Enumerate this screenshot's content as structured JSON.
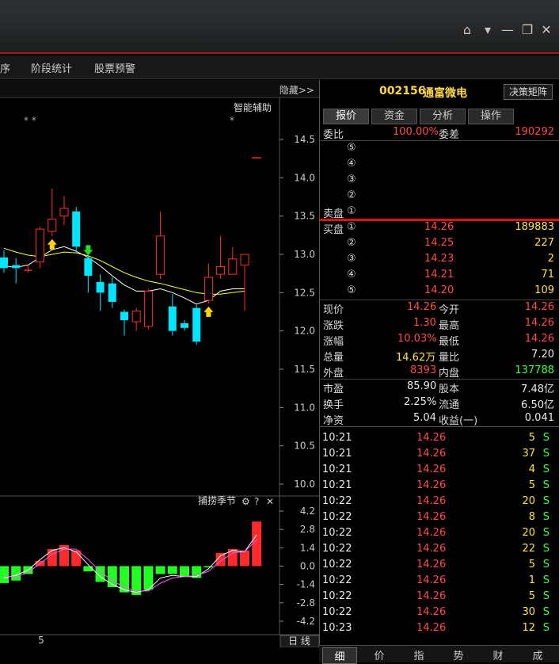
{
  "menu": {
    "items": [
      "序",
      "阶段统计",
      "股票预警"
    ]
  },
  "chart": {
    "hide_label": "隐藏>>",
    "assist_label": "智能辅助",
    "stars_left": "* *",
    "star_right": "*",
    "price_ticks": [
      "14.5",
      "14.0",
      "13.5",
      "13.0",
      "12.5",
      "12.0",
      "11.5",
      "11.0",
      "10.5",
      "10.0"
    ],
    "indicator_title": "捕捞季节",
    "indicator_ticks": [
      "4.2",
      "2.8",
      "1.4",
      "0.0",
      "-1.4",
      "-2.8",
      "-4.2"
    ],
    "date_label": "5",
    "period_label": "日 线",
    "colors": {
      "up": "#ff2b2b",
      "down": "#00e5ff",
      "ma1": "#ffffff",
      "ma2": "#ffff33",
      "macd_neg": "#22ff22"
    }
  },
  "stock": {
    "code": "002156",
    "name": "通富微电",
    "button": "决策矩阵"
  },
  "tabs": [
    "报价",
    "资金",
    "分析",
    "操作"
  ],
  "quote": {
    "wb_label": "委比",
    "wb_value": "100.00%",
    "wc_label": "委差",
    "wc_value": "190292",
    "sell_levels": [
      "⑤",
      "④",
      "③",
      "②",
      "①"
    ],
    "sell_label": "卖盘",
    "buy_label": "买盘",
    "buy_levels": [
      {
        "level": "①",
        "price": "14.26",
        "vol": "189883"
      },
      {
        "level": "②",
        "price": "14.25",
        "vol": "227"
      },
      {
        "level": "③",
        "price": "14.23",
        "vol": "2"
      },
      {
        "level": "④",
        "price": "14.21",
        "vol": "71"
      },
      {
        "level": "⑤",
        "price": "14.20",
        "vol": "109"
      }
    ],
    "stats": [
      {
        "l1": "现价",
        "v1": "14.26",
        "l2": "今开",
        "v2": "14.26"
      },
      {
        "l1": "涨跌",
        "v1": "1.30",
        "l2": "最高",
        "v2": "14.26"
      },
      {
        "l1": "涨幅",
        "v1": "10.03%",
        "l2": "最低",
        "v2": "14.26"
      },
      {
        "l1": "总量",
        "v1": "14.62万",
        "l2": "量比",
        "v2": "7.20"
      },
      {
        "l1": "外盘",
        "v1": "8393",
        "l2": "内盘",
        "v2": "137788"
      }
    ],
    "fund": [
      {
        "l1": "市盈",
        "v1": "85.90",
        "l2": "股本",
        "v2": "7.48亿"
      },
      {
        "l1": "换手",
        "v1": "2.25%",
        "l2": "流通",
        "v2": "6.50亿"
      },
      {
        "l1": "净资",
        "v1": "5.04",
        "l2": "收益(一)",
        "v2": "0.041"
      }
    ]
  },
  "ticks": [
    {
      "time": "10:21",
      "price": "14.26",
      "vol": "5",
      "side": "S"
    },
    {
      "time": "10:21",
      "price": "14.26",
      "vol": "37",
      "side": "S"
    },
    {
      "time": "10:21",
      "price": "14.26",
      "vol": "4",
      "side": "S"
    },
    {
      "time": "10:21",
      "price": "14.26",
      "vol": "5",
      "side": "S"
    },
    {
      "time": "10:22",
      "price": "14.26",
      "vol": "20",
      "side": "S"
    },
    {
      "time": "10:22",
      "price": "14.26",
      "vol": "8",
      "side": "S"
    },
    {
      "time": "10:22",
      "price": "14.26",
      "vol": "20",
      "side": "S"
    },
    {
      "time": "10:22",
      "price": "14.26",
      "vol": "22",
      "side": "S"
    },
    {
      "time": "10:22",
      "price": "14.26",
      "vol": "5",
      "side": "S"
    },
    {
      "time": "10:22",
      "price": "14.26",
      "vol": "1",
      "side": "S"
    },
    {
      "time": "10:22",
      "price": "14.26",
      "vol": "5",
      "side": "S"
    },
    {
      "time": "10:22",
      "price": "14.26",
      "vol": "30",
      "side": "S"
    },
    {
      "time": "10:23",
      "price": "14.26",
      "vol": "12",
      "side": "S"
    }
  ],
  "bottom_tabs": [
    "细",
    "价",
    "指",
    "势",
    "财",
    "成"
  ],
  "candles": [
    {
      "o": 12.96,
      "c": 12.82,
      "h": 13.05,
      "l": 12.76
    },
    {
      "o": 12.86,
      "c": 12.82,
      "h": 12.95,
      "l": 12.62
    },
    {
      "o": 12.79,
      "c": 12.8,
      "h": 12.86,
      "l": 12.76
    },
    {
      "o": 12.9,
      "c": 13.33,
      "h": 13.36,
      "l": 12.82
    },
    {
      "o": 13.3,
      "c": 13.46,
      "h": 13.86,
      "l": 13.24
    },
    {
      "o": 13.5,
      "c": 13.6,
      "h": 13.76,
      "l": 13.38
    },
    {
      "o": 13.56,
      "c": 13.1,
      "h": 13.62,
      "l": 13.02
    },
    {
      "o": 12.95,
      "c": 12.72,
      "h": 13.1,
      "l": 12.5
    },
    {
      "o": 12.64,
      "c": 12.5,
      "h": 12.74,
      "l": 12.26
    },
    {
      "o": 12.62,
      "c": 12.38,
      "h": 12.7,
      "l": 12.3
    },
    {
      "o": 12.25,
      "c": 12.14,
      "h": 12.28,
      "l": 11.94
    },
    {
      "o": 12.12,
      "c": 12.26,
      "h": 12.3,
      "l": 12.0
    },
    {
      "o": 12.06,
      "c": 12.52,
      "h": 12.55,
      "l": 12.02
    },
    {
      "o": 12.74,
      "c": 13.24,
      "h": 13.56,
      "l": 12.68
    },
    {
      "o": 12.32,
      "c": 12.0,
      "h": 12.48,
      "l": 11.94
    },
    {
      "o": 12.1,
      "c": 12.04,
      "h": 12.14,
      "l": 12.0
    },
    {
      "o": 12.3,
      "c": 11.86,
      "h": 12.34,
      "l": 11.82
    },
    {
      "o": 12.4,
      "c": 12.7,
      "h": 12.88,
      "l": 12.36
    },
    {
      "o": 12.74,
      "c": 12.84,
      "h": 13.24,
      "l": 12.68
    },
    {
      "o": 12.74,
      "c": 12.94,
      "h": 13.09,
      "l": 12.74
    },
    {
      "o": 12.86,
      "c": 13.0,
      "h": 13.0,
      "l": 12.26
    },
    {
      "o": 14.26,
      "c": 14.26,
      "h": 14.26,
      "l": 14.26
    }
  ],
  "ma1": [
    12.85,
    12.83,
    12.86,
    12.96,
    13.06,
    13.1,
    13.04,
    12.96,
    12.85,
    12.72,
    12.6,
    12.52,
    12.52,
    12.55,
    12.5,
    12.43,
    12.35,
    12.4,
    12.52,
    12.55,
    12.55,
    12.7
  ],
  "ma2": [
    13.08,
    13.03,
    12.99,
    12.97,
    13.0,
    13.03,
    13.02,
    12.98,
    12.92,
    12.84,
    12.76,
    12.7,
    12.65,
    12.62,
    12.58,
    12.54,
    12.5,
    12.48,
    12.48,
    12.5,
    12.52,
    12.62
  ],
  "arrows": [
    {
      "i": 4,
      "dir": "up"
    },
    {
      "i": 7,
      "dir": "down"
    },
    {
      "i": 17,
      "dir": "up"
    }
  ],
  "macd": [
    -1.3,
    -1.1,
    -0.6,
    0.4,
    1.3,
    1.6,
    1.2,
    -0.4,
    -1.2,
    -1.6,
    -2.0,
    -2.2,
    -1.8,
    -0.6,
    -0.6,
    -0.8,
    -0.9,
    -0.1,
    1.0,
    1.3,
    1.2,
    3.4
  ],
  "macd_line1": [
    -0.9,
    -0.7,
    -0.3,
    0.5,
    1.2,
    1.4,
    1.1,
    0.1,
    -0.8,
    -1.4,
    -1.8,
    -2.0,
    -1.8,
    -0.9,
    -0.7,
    -0.8,
    -0.8,
    -0.2,
    0.8,
    1.2,
    1.1,
    2.4
  ],
  "macd_line2": [
    -0.8,
    -0.8,
    -0.5,
    0.2,
    0.9,
    1.3,
    1.3,
    0.5,
    -0.4,
    -1.1,
    -1.6,
    -1.9,
    -1.9,
    -1.3,
    -0.9,
    -0.8,
    -0.7,
    -0.4,
    0.4,
    1.0,
    1.1,
    2.0
  ]
}
